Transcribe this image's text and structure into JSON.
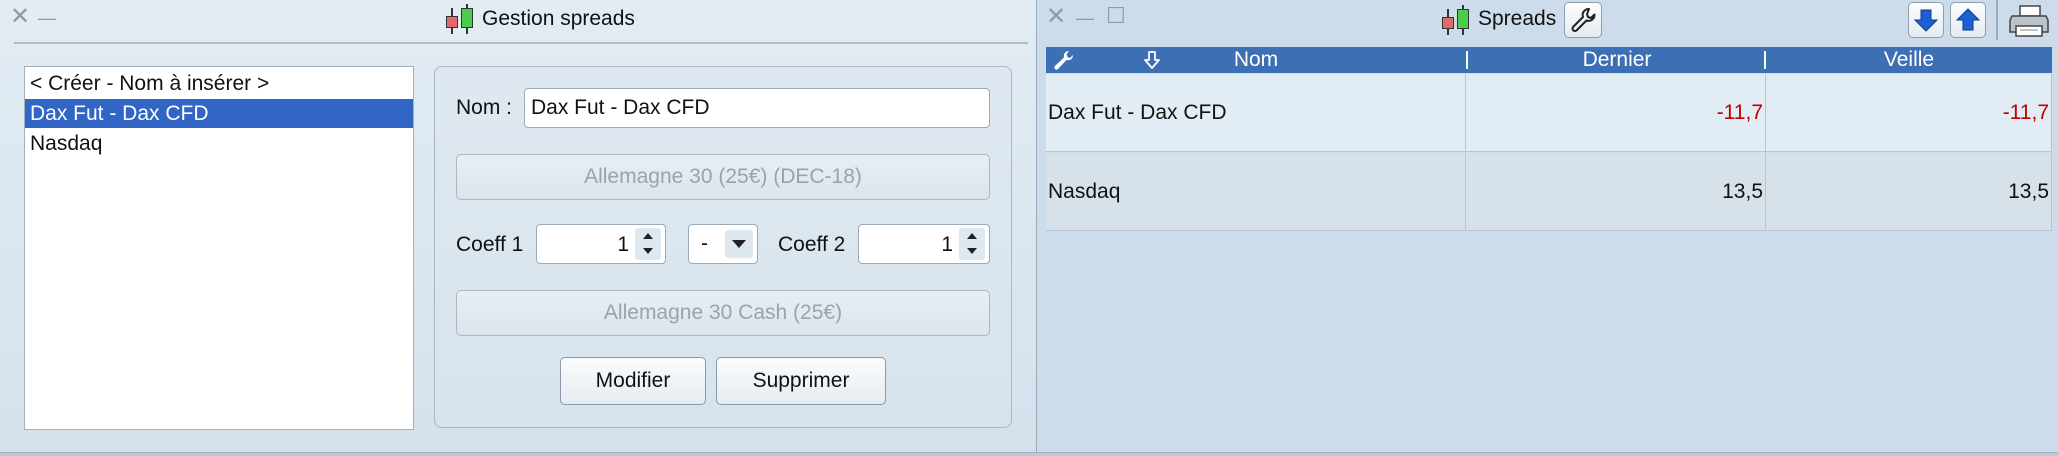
{
  "left_window": {
    "title": "Gestion spreads",
    "controls": {
      "close": "✕",
      "minimize": "—"
    },
    "list": {
      "items": [
        {
          "label": "< Créer - Nom à insérer >",
          "selected": false
        },
        {
          "label": "Dax Fut - Dax CFD",
          "selected": true
        },
        {
          "label": "Nasdaq",
          "selected": false
        }
      ]
    },
    "form": {
      "name_label": "Nom :",
      "name_value": "Dax Fut - Dax CFD",
      "instrument1_button": "Allemagne 30 (25€) (DEC-18)",
      "coeff1_label": "Coeff 1",
      "coeff1_value": "1",
      "operator_value": "-",
      "coeff2_label": "Coeff 2",
      "coeff2_value": "1",
      "instrument2_button": "Allemagne 30 Cash (25€)",
      "modify_button": "Modifier",
      "delete_button": "Supprimer"
    }
  },
  "right_window": {
    "title": "Spreads",
    "controls": {
      "close": "✕",
      "minimize": "—",
      "maximize": "☐"
    },
    "table": {
      "columns": [
        "Nom",
        "Dernier",
        "Veille"
      ],
      "rows": [
        {
          "nom": "Dax Fut - Dax CFD",
          "dernier": "-11,7",
          "veille": "-11,7"
        },
        {
          "nom": "Nasdaq",
          "dernier": "13,5",
          "veille": "13,5"
        }
      ]
    }
  },
  "colors": {
    "selection": "#3166c7",
    "header": "#3c6fb3",
    "negative": "#c00000",
    "candle_red": "#e36a6a",
    "candle_green": "#4ccc4c",
    "arrow_blue": "#1f5fd6"
  },
  "icons": [
    "candlestick-icon",
    "wrench-icon",
    "sort-down-icon",
    "arrow-down-icon",
    "arrow-up-icon",
    "printer-icon"
  ]
}
